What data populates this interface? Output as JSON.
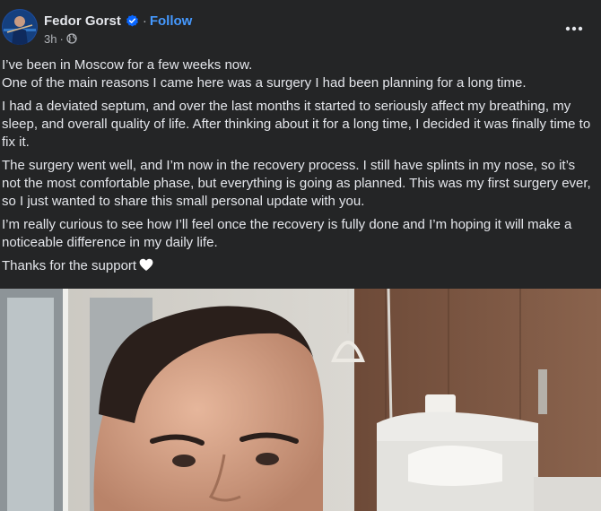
{
  "post": {
    "author": "Fedor Gorst",
    "follow_label": "Follow",
    "dot": "·",
    "time": "3h",
    "audience_icon": "globe-icon",
    "verified_icon": "verified-badge-icon",
    "more_icon": "more-options-icon",
    "paragraphs": [
      "I’ve been in Moscow for a few weeks now.",
      "One of the main reasons I came here was a surgery I had been planning for a long time.",
      "I had a deviated septum, and over the last months it started to seriously affect my breathing, my sleep, and overall quality of life. After thinking about it for a long time, I decided it was finally time to fix it.",
      "The surgery went well, and I’m now in the recovery process. I still have splints in my nose, so it’s not the most comfortable phase, but everything is going as planned. This was my first surgery ever, so I just wanted to share this small personal update with you.",
      "I’m really curious to see how I’ll feel once the recovery is fully done and I’m hoping it will make a noticeable difference in my daily life.",
      "Thanks for the support"
    ],
    "heart_icon": "white-heart-emoji-icon"
  },
  "colors": {
    "background": "#242526",
    "text": "#e4e6eb",
    "secondary_text": "#b0b3b8",
    "link_blue": "#4599ff",
    "verified_blue": "#0866ff"
  }
}
